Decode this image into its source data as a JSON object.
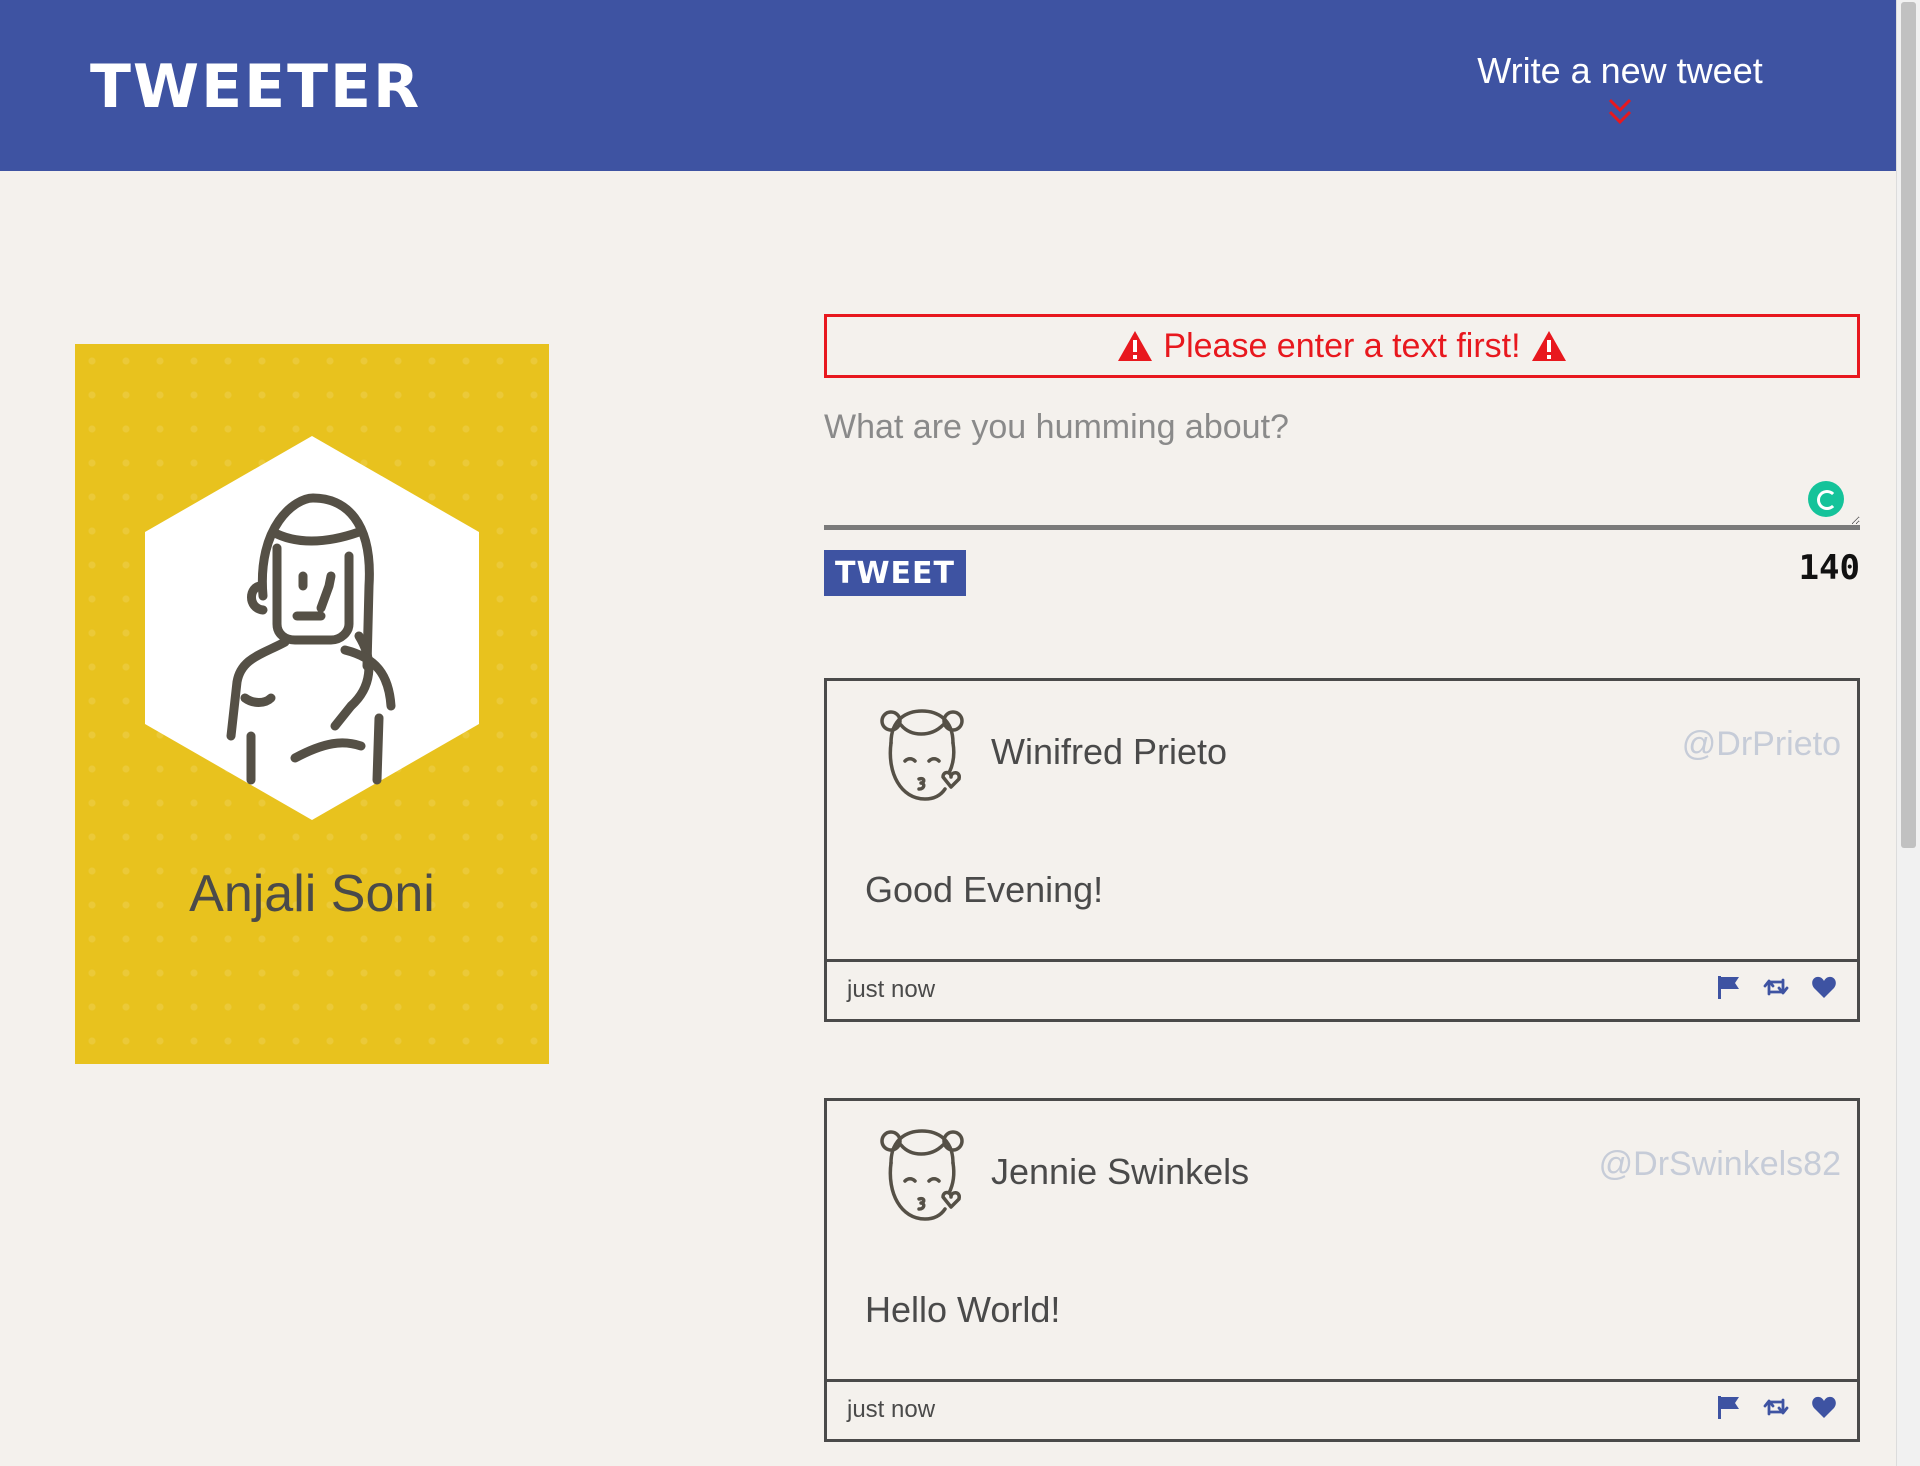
{
  "nav": {
    "logo": "TWEETER",
    "compose_bold": "Write",
    "compose_rest": " a new tweet"
  },
  "profile": {
    "name": "Anjali Soni"
  },
  "compose": {
    "error": "Please enter a text first!",
    "placeholder": "What are you humming about?",
    "button": "TWEET",
    "counter": "140"
  },
  "tweets": [
    {
      "author": "Winifred Prieto",
      "handle": "@DrPrieto",
      "text": "Good Evening!",
      "time": "just now"
    },
    {
      "author": "Jennie Swinkels",
      "handle": "@DrSwinkels82",
      "text": "Hello World!",
      "time": "just now"
    }
  ],
  "colors": {
    "nav": "#3e53a2",
    "background": "#f4f1ed",
    "profile_card": "#e8c21e",
    "error": "#e8181e",
    "handle": "#c6ccd8"
  },
  "icons": [
    "chevron-double-down-icon",
    "warning-icon",
    "flag-icon",
    "retweet-icon",
    "heart-icon"
  ]
}
